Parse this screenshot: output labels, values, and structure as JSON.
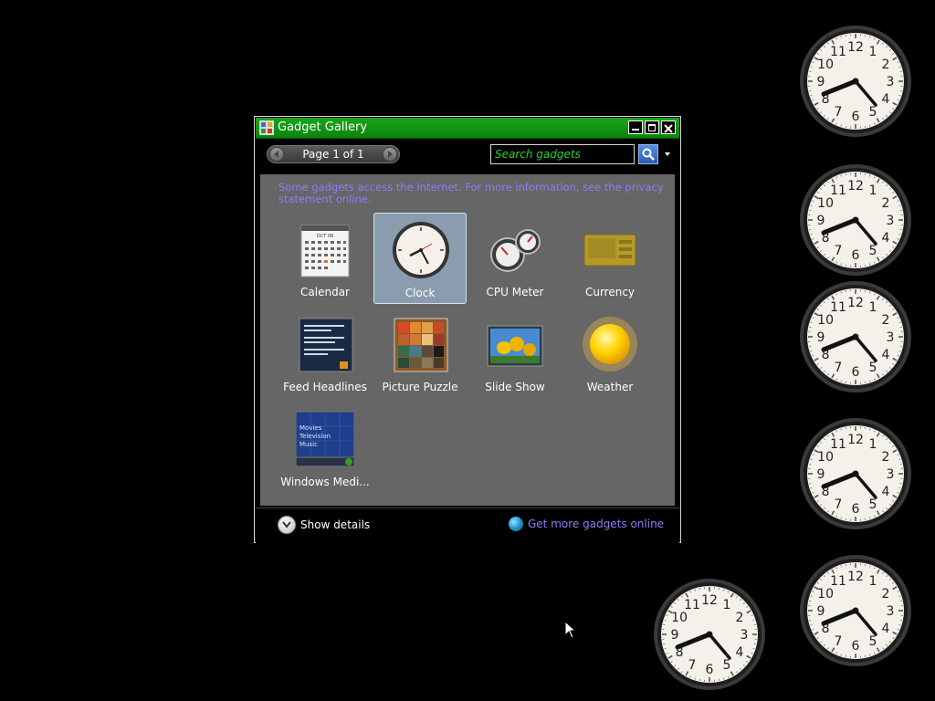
{
  "colors": {
    "titlebar": "#10991a",
    "panel": "#666666",
    "link": "#8c7df5",
    "search_text": "#2dd12d"
  },
  "desktop": {
    "clock_gadgets": [
      {
        "icon": "clock-face"
      },
      {
        "icon": "clock-face"
      },
      {
        "icon": "clock-face"
      },
      {
        "icon": "clock-face"
      },
      {
        "icon": "clock-face"
      },
      {
        "icon": "clock-face"
      }
    ],
    "clock_numbers": [
      "12",
      "1",
      "2",
      "3",
      "4",
      "5",
      "6",
      "7",
      "8",
      "9",
      "10",
      "11"
    ]
  },
  "window": {
    "title": "Gadget Gallery",
    "page_label": "Page 1 of 1",
    "search_placeholder": "Search gadgets",
    "notice": "Some gadgets access the Internet.  For more information, see the privacy statement online.",
    "gadgets": [
      {
        "label": "Calendar",
        "icon": "calendar-icon",
        "selected": false
      },
      {
        "label": "Clock",
        "icon": "clock-icon",
        "selected": true
      },
      {
        "label": "CPU Meter",
        "icon": "cpu-meter-icon",
        "selected": false
      },
      {
        "label": "Currency",
        "icon": "currency-icon",
        "selected": false
      },
      {
        "label": "Feed Headlines",
        "icon": "feed-headlines-icon",
        "selected": false
      },
      {
        "label": "Picture Puzzle",
        "icon": "picture-puzzle-icon",
        "selected": false
      },
      {
        "label": "Slide Show",
        "icon": "slide-show-icon",
        "selected": false
      },
      {
        "label": "Weather",
        "icon": "weather-icon",
        "selected": false
      },
      {
        "label": "Windows Medi...",
        "icon": "windows-media-center-icon",
        "selected": false
      }
    ],
    "calendar_month": "OCT 08",
    "media_center_items": [
      "Movies",
      "Television",
      "Music"
    ],
    "footer": {
      "details_label": "Show details",
      "more_link": "Get more gadgets online"
    }
  }
}
